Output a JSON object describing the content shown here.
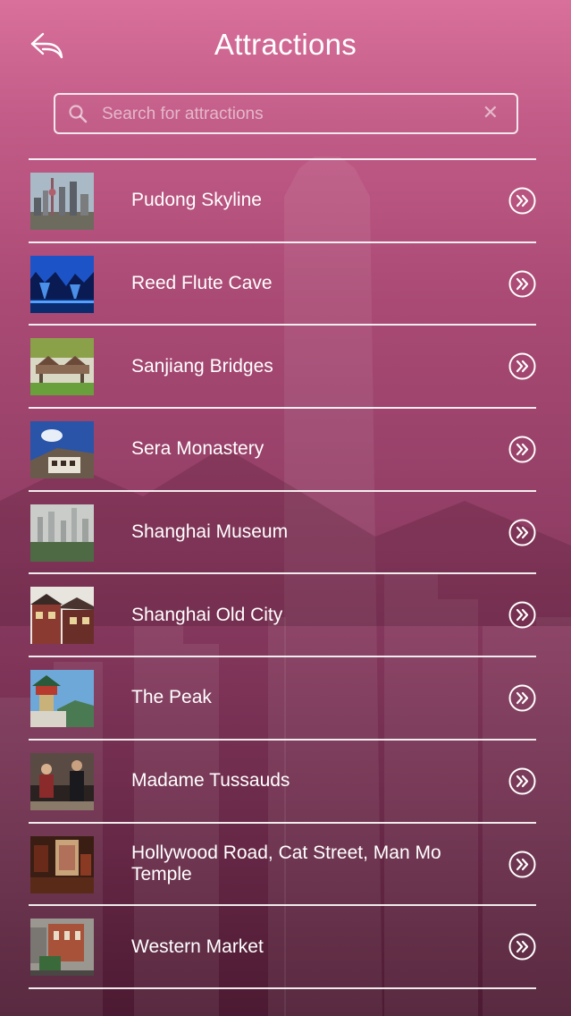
{
  "header": {
    "title": "Attractions"
  },
  "search": {
    "placeholder": "Search for attractions",
    "value": ""
  },
  "attractions": [
    {
      "label": "Pudong Skyline"
    },
    {
      "label": "Reed Flute Cave"
    },
    {
      "label": "Sanjiang Bridges"
    },
    {
      "label": "Sera Monastery"
    },
    {
      "label": "Shanghai Museum"
    },
    {
      "label": "Shanghai Old City"
    },
    {
      "label": "The Peak"
    },
    {
      "label": "Madame Tussauds"
    },
    {
      "label": "Hollywood Road, Cat Street, Man Mo Temple"
    },
    {
      "label": "Western Market"
    }
  ],
  "icons": {
    "back": "back-arrow-icon",
    "search": "search-icon",
    "clear": "clear-icon",
    "row_action": "double-chevron-right-circle-icon"
  },
  "colors": {
    "background_top": "#d9709c",
    "background_bottom": "#4c1a32",
    "text": "#ffffff"
  }
}
